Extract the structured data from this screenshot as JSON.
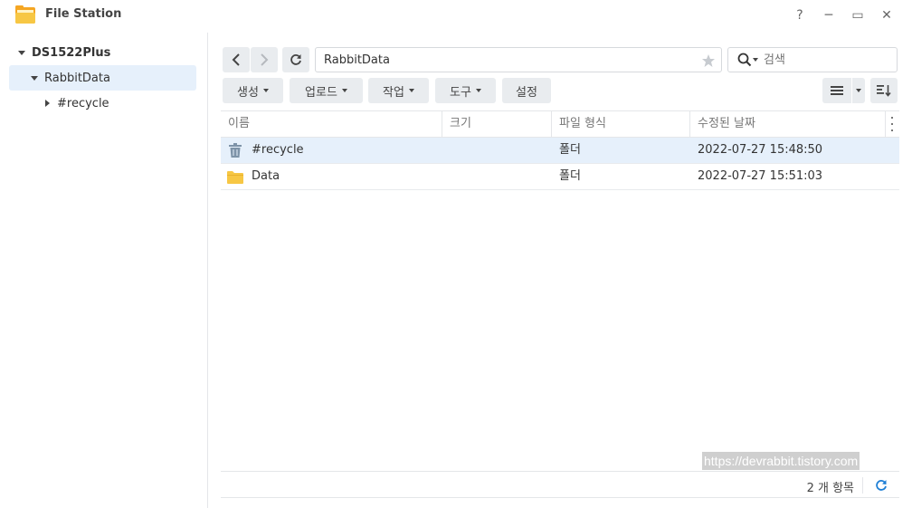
{
  "window": {
    "title": "File Station",
    "controls": {
      "help": "?",
      "minimize": "─",
      "maximize": "▭",
      "close": "✕"
    }
  },
  "sidebar": {
    "root": "DS1522Plus",
    "share": "RabbitData",
    "child": "#recycle"
  },
  "nav": {
    "path": "RabbitData",
    "search_placeholder": "검색"
  },
  "toolbar": {
    "create": "생성",
    "upload": "업로드",
    "action": "작업",
    "tools": "도구",
    "settings": "설정"
  },
  "table": {
    "columns": [
      "이름",
      "크기",
      "파일 형식",
      "수정된 날짜"
    ],
    "rows": [
      {
        "name": "#recycle",
        "size": "",
        "type": "폴더",
        "modified": "2022-07-27 15:48:50"
      },
      {
        "name": "Data",
        "size": "",
        "type": "폴더",
        "modified": "2022-07-27 15:51:03"
      }
    ]
  },
  "footer": {
    "count": "2 개 항목"
  },
  "watermark": "https://devrabbit.tistory.com",
  "colors": {
    "accent": "#1e7fd6",
    "selected_bg": "#e6f0fb",
    "button_bg": "#e9ecef",
    "folder": "#f7c744",
    "recycle": "#7e93a8"
  }
}
